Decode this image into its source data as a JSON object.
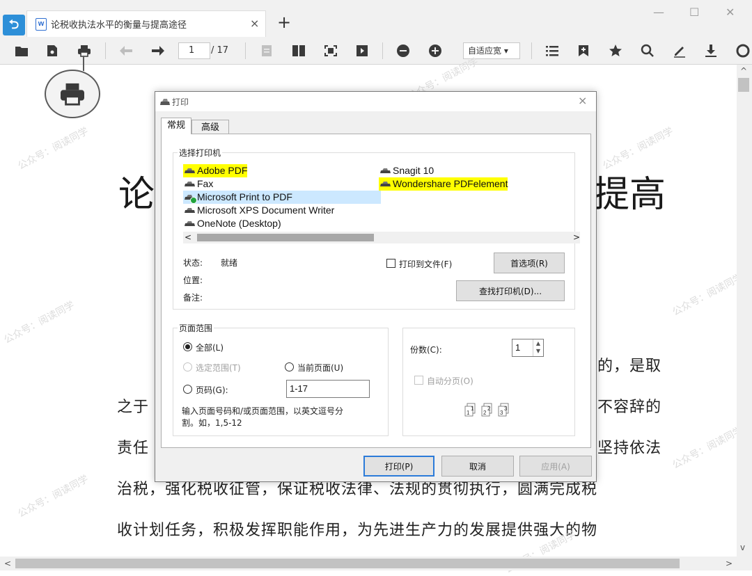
{
  "window": {
    "tab_title": "论税收执法水平的衡量与提高途径",
    "tab_icon_letter": "w",
    "new_tab": "+",
    "tab_close": "×",
    "minimize": "—",
    "maximize": "☐",
    "close": "✕"
  },
  "toolbar": {
    "page_current": "1",
    "page_total": "/ 17",
    "zoom": "自适应宽 ▾"
  },
  "document": {
    "title_left": "论",
    "title_right": "提高",
    "lines": [
      {
        "text": "的，是取"
      },
      {
        "left": "之于",
        "right": "不容辞的"
      },
      {
        "left": "责任",
        "right": "坚持依法"
      },
      {
        "text": "治税，强化税收征管，保证税收法律、法规的贯彻执行，圆满完成税"
      },
      {
        "text": "收计划任务，积极发挥职能作用，为先进生产力的发展提供强大的物"
      }
    ],
    "watermark": "公众号：阅读同学"
  },
  "scrollbars": {
    "up": "^",
    "down": "v",
    "left": "<",
    "right": ">"
  },
  "dialog": {
    "title": "打印",
    "close": "×",
    "tabs": {
      "general": "常规",
      "advanced": "高级"
    },
    "select_printer_label": "选择打印机",
    "printers": [
      {
        "name": "Adobe PDF"
      },
      {
        "name": "Fax"
      },
      {
        "name": "Microsoft Print to PDF"
      },
      {
        "name": "Microsoft XPS Document Writer"
      },
      {
        "name": "OneNote (Desktop)"
      },
      {
        "name": "Snagit 10"
      },
      {
        "name": "Wondershare PDFelement"
      }
    ],
    "list_scroll_left": "<",
    "list_scroll_right": ">",
    "status_label": "状态:",
    "status_value": "就绪",
    "location_label": "位置:",
    "comment_label": "备注:",
    "print_to_file": "打印到文件(F)",
    "preferences_button": "首选项(R)",
    "find_printer_button": "查找打印机(D)...",
    "page_range": {
      "label": "页面范围",
      "all": "全部(L)",
      "selection": "选定范围(T)",
      "current_page": "当前页面(U)",
      "pages": "页码(G):",
      "pages_value": "1-17",
      "hint_line1": "输入页面号码和/或页面范围，以英文逗号分",
      "hint_line2": "割。如，1,5-12"
    },
    "copies_label": "份数(C):",
    "copies_value": "1",
    "collate": "自动分页(O)",
    "collate_pages": [
      "1",
      "1",
      "2",
      "2",
      "3",
      "3"
    ],
    "print_button": "打印(P)",
    "cancel_button": "取消",
    "apply_button": "应用(A)"
  }
}
